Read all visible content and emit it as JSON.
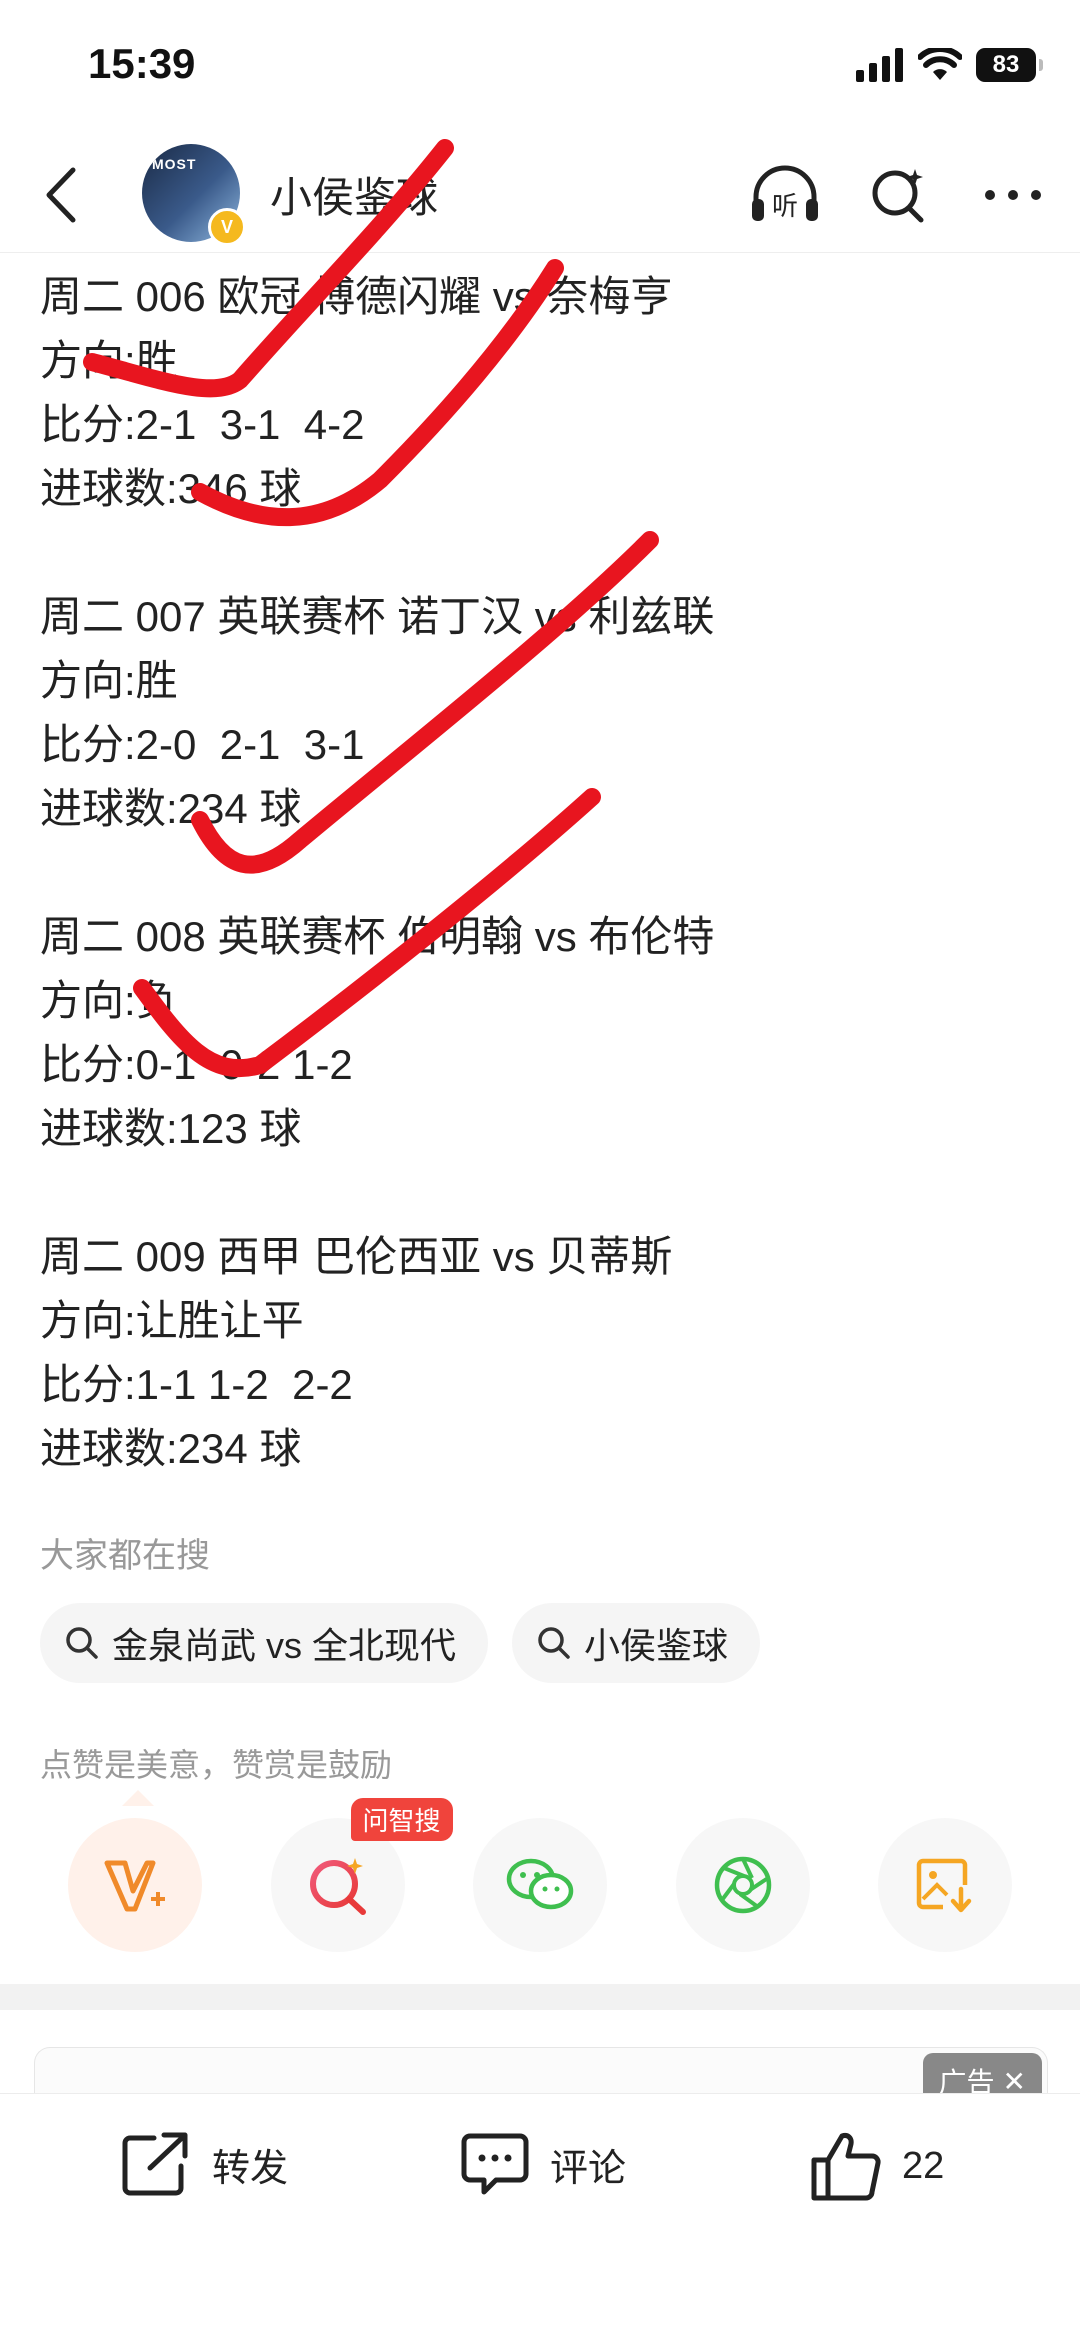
{
  "status_bar": {
    "time": "15:39",
    "battery": "83"
  },
  "header": {
    "author": "小侯鉴球",
    "avatar_text": "MOST",
    "verified_badge": "V"
  },
  "matches": [
    {
      "title": "周二 006 欧冠 博德闪耀 vs 奈梅亨",
      "direction": "方向:胜",
      "score": "比分:2-1  3-1  4-2",
      "goals": "进球数:346 球"
    },
    {
      "title": "周二 007 英联赛杯 诺丁汉 vs 利兹联",
      "direction": "方向:胜",
      "score": "比分:2-0  2-1  3-1",
      "goals": "进球数:234 球"
    },
    {
      "title": "周二 008 英联赛杯 伯明翰 vs 布伦特",
      "direction": "方向:负",
      "score": "比分:0-1  0-2 1-2",
      "goals": "进球数:123 球"
    },
    {
      "title": "周二 009 西甲 巴伦西亚 vs 贝蒂斯",
      "direction": "方向:让胜让平",
      "score": "比分:1-1 1-2  2-2",
      "goals": "进球数:234 球"
    }
  ],
  "search": {
    "title": "大家都在搜",
    "chips": [
      "金泉尚武 vs 全北现代",
      "小侯鉴球"
    ]
  },
  "praise": {
    "text": "点赞是美意，赞赏是鼓励",
    "ai_badge": "问智搜"
  },
  "ad": {
    "label": "广告",
    "close": "✕"
  },
  "bottom_bar": {
    "share": "转发",
    "comment": "评论",
    "like_count": "22"
  },
  "colors": {
    "accent_orange": "#f08a2a",
    "ai_red": "#f0443c",
    "wechat_green": "#3fbf4f",
    "check_red": "#e8151f"
  },
  "icons": [
    "back-icon",
    "headphones-icon",
    "search-icon",
    "more-icon",
    "vip-icon",
    "ai-search-icon",
    "wechat-icon",
    "moments-icon",
    "save-image-icon",
    "share-icon",
    "comment-icon",
    "like-icon"
  ]
}
